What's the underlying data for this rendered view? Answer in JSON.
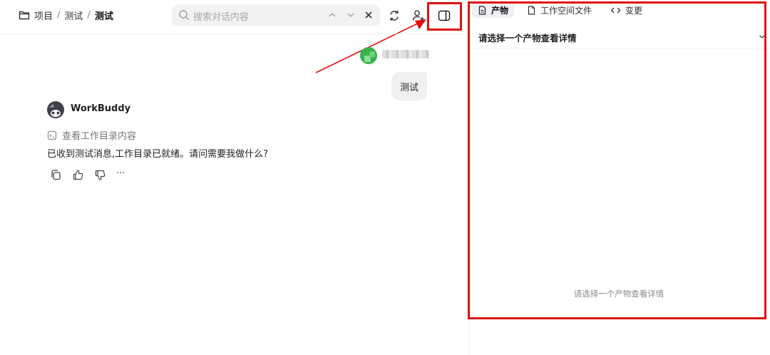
{
  "breadcrumb": {
    "root": "项目",
    "separator": "/",
    "mid": "测试",
    "current": "测试"
  },
  "search": {
    "placeholder": "搜索对话内容"
  },
  "chat": {
    "user_message": "测试",
    "bot_name": "WorkBuddy",
    "tool_step": "查看工作目录内容",
    "bot_reply": "已收到测试消息,工作目录已就绪。请问需要我做什么?",
    "more_label": "···"
  },
  "right_panel": {
    "tabs": [
      {
        "label": "产物",
        "icon": "document-icon",
        "active": true
      },
      {
        "label": "工作空间文件",
        "icon": "file-icon",
        "active": false
      },
      {
        "label": "变更",
        "icon": "code-icon",
        "active": false
      }
    ],
    "select_label": "请选择一个产物查看详情",
    "empty_message": "请选择一个产物查看详情"
  },
  "annotation": {
    "color": "#e01010"
  }
}
